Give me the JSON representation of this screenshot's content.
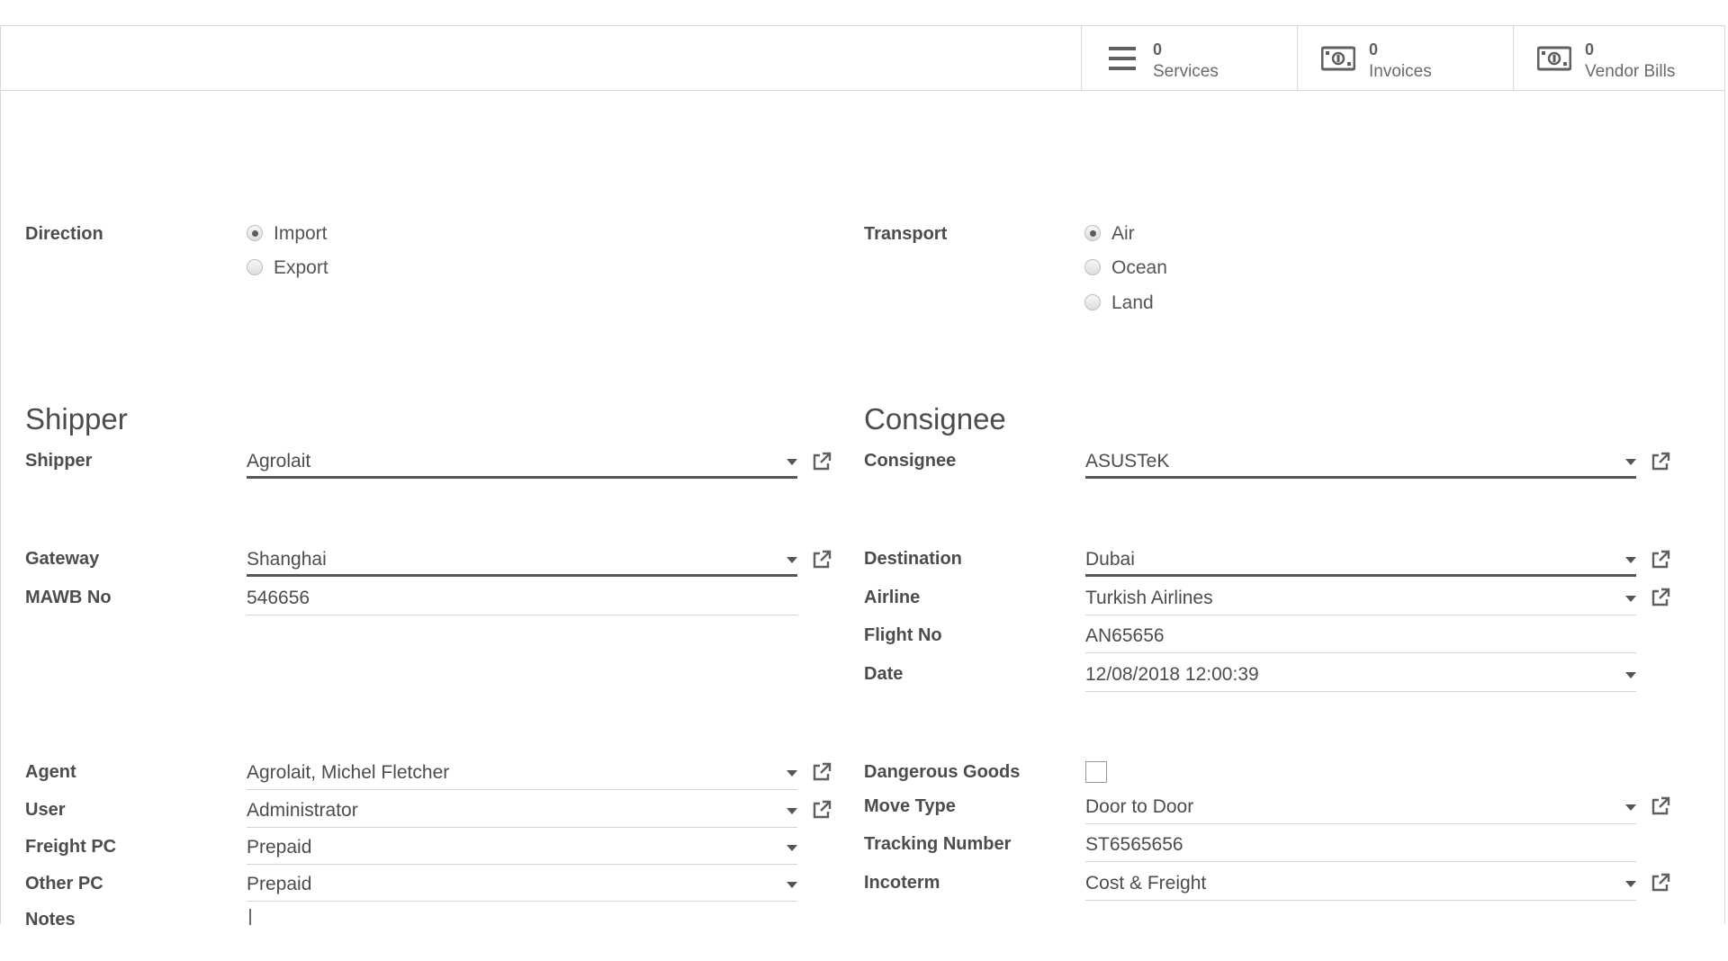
{
  "stat_buttons": [
    {
      "count": "0",
      "label": "Services",
      "icon": "list-icon"
    },
    {
      "count": "0",
      "label": "Invoices",
      "icon": "money-icon"
    },
    {
      "count": "0",
      "label": "Vendor Bills",
      "icon": "money-icon"
    }
  ],
  "direction": {
    "label": "Direction",
    "options": [
      "Import",
      "Export"
    ],
    "selected": "Import"
  },
  "transport": {
    "label": "Transport",
    "options": [
      "Air",
      "Ocean",
      "Land"
    ],
    "selected": "Air"
  },
  "shipper_section": {
    "title": "Shipper"
  },
  "consignee_section": {
    "title": "Consignee"
  },
  "left_fields": {
    "shipper": {
      "label": "Shipper",
      "value": "Agrolait"
    },
    "gateway": {
      "label": "Gateway",
      "value": "Shanghai"
    },
    "mawb": {
      "label": "MAWB No",
      "value": "546656"
    },
    "agent": {
      "label": "Agent",
      "value": "Agrolait, Michel Fletcher"
    },
    "user": {
      "label": "User",
      "value": "Administrator"
    },
    "freight_pc": {
      "label": "Freight PC",
      "value": "Prepaid"
    },
    "other_pc": {
      "label": "Other PC",
      "value": "Prepaid"
    },
    "notes": {
      "label": "Notes",
      "value": ""
    }
  },
  "right_fields": {
    "consignee": {
      "label": "Consignee",
      "value": "ASUSTeK"
    },
    "destination": {
      "label": "Destination",
      "value": "Dubai"
    },
    "airline": {
      "label": "Airline",
      "value": "Turkish Airlines"
    },
    "flight_no": {
      "label": "Flight No",
      "value": "AN65656"
    },
    "date": {
      "label": "Date",
      "value": "12/08/2018 12:00:39"
    },
    "dangerous_goods": {
      "label": "Dangerous Goods",
      "checked": false
    },
    "move_type": {
      "label": "Move Type",
      "value": "Door to Door"
    },
    "tracking_number": {
      "label": "Tracking Number",
      "value": "ST6565656"
    },
    "incoterm": {
      "label": "Incoterm",
      "value": "Cost & Freight"
    }
  },
  "colors": {
    "text": "#4c4c4c",
    "border": "#d9d9d9",
    "required_underline": "#555555",
    "background": "#ffffff"
  }
}
